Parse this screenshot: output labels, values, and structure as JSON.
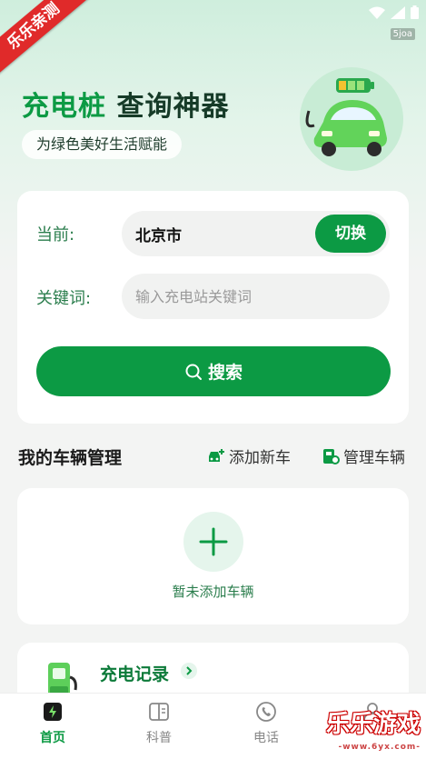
{
  "status_bar": {
    "tag": "5joa"
  },
  "ribbon": {
    "text": "乐乐亲测"
  },
  "brand": {
    "title_a": "充电桩",
    "title_b": "查询神器",
    "slogan": "为绿色美好生活赋能"
  },
  "search": {
    "current_label": "当前:",
    "city": "北京市",
    "switch_label": "切换",
    "keyword_label": "关键词:",
    "keyword_placeholder": "输入充电站关键词",
    "keyword_value": "",
    "search_label": "搜索"
  },
  "vehicles": {
    "title": "我的车辆管理",
    "add_label": "添加新车",
    "manage_label": "管理车辆",
    "empty_text": "暂未添加车辆"
  },
  "records": {
    "title": "充电记录"
  },
  "tabs": [
    {
      "label": "首页",
      "icon": "home-bolt-icon",
      "active": true
    },
    {
      "label": "科普",
      "icon": "book-icon",
      "active": false
    },
    {
      "label": "电话",
      "icon": "phone-icon",
      "active": false
    },
    {
      "label": "",
      "icon": "user-icon",
      "active": false
    }
  ],
  "watermark": {
    "text": "乐乐游戏",
    "sub": "-www.6yx.com-"
  },
  "colors": {
    "primary": "#0c9a44",
    "dark_text": "#163b28",
    "label_green": "#2a7d4c"
  }
}
